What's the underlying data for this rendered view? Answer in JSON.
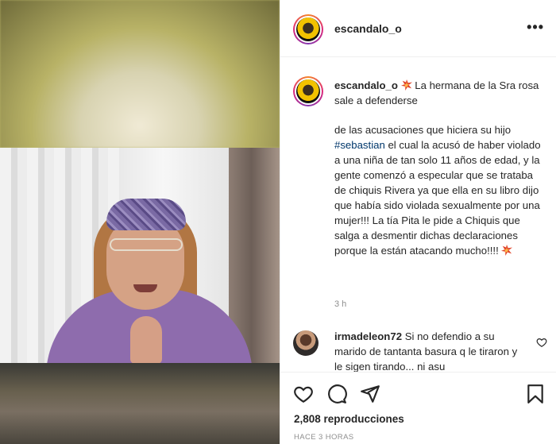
{
  "post": {
    "username": "escandalo_o",
    "more_label": "•••"
  },
  "caption": {
    "username": "escandalo_o",
    "line1": "La hermana de la Sra rosa sale a defenderse",
    "hashtag": "#sebastian",
    "text_before_tag": "de las acusaciones que hiciera su hijo",
    "text_after_tag": "el cual la acusó de haber violado a una niña de tan solo 11 años de edad, y la gente comenzó a especular que se trataba de chiquis Rivera ya que ella en su libro dijo que había sido violada sexualmente por una mujer!!! La tía Pita le pide a Chiquis que salga a desmentir dichas declaraciones porque la están atacando mucho!!!!",
    "time": "3 h",
    "emoji_icon": "collision-emoji-icon"
  },
  "comment": {
    "username": "irmadeleon72",
    "text": "Si no defendio a su marido de tantanta basura q le tiraron y le sigen tirando... ni asu"
  },
  "actions": {
    "icons": [
      "heart-icon",
      "comment-icon",
      "share-icon",
      "bookmark-icon"
    ],
    "views": "2,808 reproducciones",
    "posted": "HACE 3 HORAS"
  },
  "colors": {
    "hashtag": "#00376b",
    "muted": "#8e8e8e",
    "text": "#262626"
  }
}
